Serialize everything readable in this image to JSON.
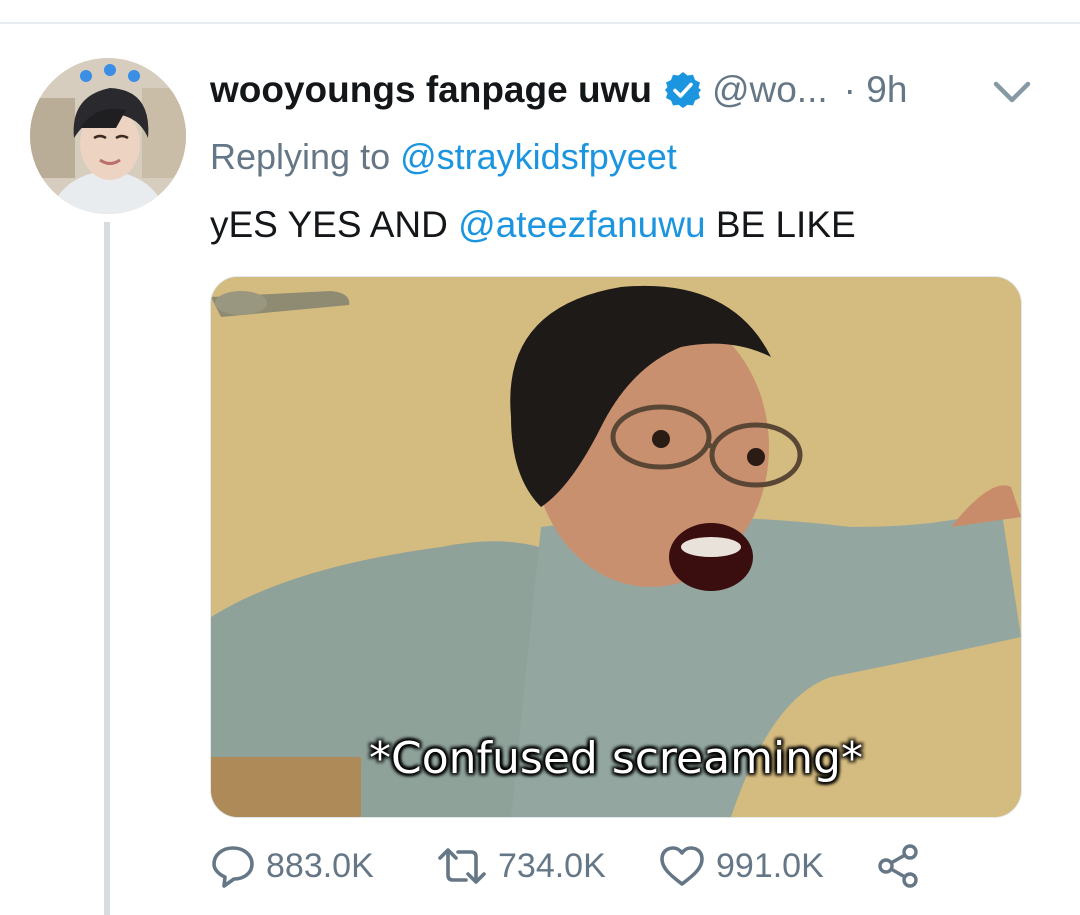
{
  "tweet": {
    "display_name": "wooyoungs fanpage uwu",
    "handle": "@wo...",
    "separator_time": "· 9h",
    "replying_prefix": "Replying to",
    "replying_to": "@straykidsfpyeet",
    "text_before": "yES YES AND",
    "text_mention": "@ateezfanuwu",
    "text_after": "BE LIKE",
    "media_caption": "*Confused screaming*"
  },
  "actions": {
    "reply_count": "883.0K",
    "retweet_count": "734.0K",
    "like_count": "991.0K"
  },
  "icons": {
    "verified": "verified-badge-icon",
    "caret": "chevron-down-icon",
    "reply": "reply-bubble-icon",
    "retweet": "retweet-icon",
    "like": "heart-icon",
    "share": "share-icon"
  },
  "colors": {
    "accent": "#1b95e0",
    "muted": "#657786",
    "text": "#14171a",
    "thread_line": "#d6dce0"
  }
}
